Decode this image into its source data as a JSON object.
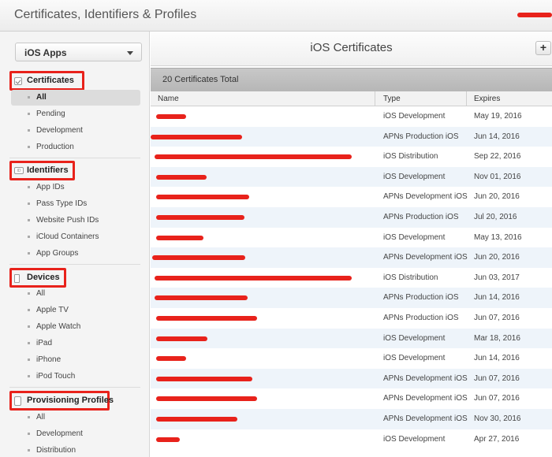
{
  "header": {
    "title": "Certificates, Identifiers & Profiles"
  },
  "sidebar": {
    "select_value": "iOS Apps",
    "sections": [
      {
        "label": "Certificates",
        "icon": "certificate-icon",
        "items": [
          "All",
          "Pending",
          "Development",
          "Production"
        ]
      },
      {
        "label": "Identifiers",
        "icon": "id-icon",
        "items": [
          "App IDs",
          "Pass Type IDs",
          "Website Push IDs",
          "iCloud Containers",
          "App Groups"
        ]
      },
      {
        "label": "Devices",
        "icon": "device-icon",
        "items": [
          "All",
          "Apple TV",
          "Apple Watch",
          "iPad",
          "iPhone",
          "iPod Touch"
        ]
      },
      {
        "label": "Provisioning Profiles",
        "icon": "profile-icon",
        "items": [
          "All",
          "Development",
          "Distribution"
        ]
      }
    ]
  },
  "main": {
    "title": "iOS Certificates",
    "add_label": "+",
    "total": "20 Certificates Total",
    "columns": [
      "Name",
      "Type",
      "Expires"
    ],
    "rows": [
      {
        "type": "iOS Development",
        "expires": "May 19, 2016"
      },
      {
        "type": "APNs Production iOS",
        "expires": "Jun 14, 2016"
      },
      {
        "type": "iOS Distribution",
        "expires": "Sep 22, 2016"
      },
      {
        "type": "iOS Development",
        "expires": "Nov 01, 2016"
      },
      {
        "type": "APNs Development iOS",
        "expires": "Jun 20, 2016"
      },
      {
        "type": "APNs Production iOS",
        "expires": "Jul 20, 2016"
      },
      {
        "type": "iOS Development",
        "expires": "May 13, 2016"
      },
      {
        "type": "APNs Development iOS",
        "expires": "Jun 20, 2016"
      },
      {
        "type": "iOS Distribution",
        "expires": "Jun 03, 2017"
      },
      {
        "type": "APNs Production iOS",
        "expires": "Jun 14, 2016"
      },
      {
        "type": "APNs Production iOS",
        "expires": "Jun 07, 2016"
      },
      {
        "type": "iOS Development",
        "expires": "Mar 18, 2016"
      },
      {
        "type": "iOS Development",
        "expires": "Jun 14, 2016"
      },
      {
        "type": "APNs Development iOS",
        "expires": "Jun 07, 2016"
      },
      {
        "type": "APNs Development iOS",
        "expires": "Jun 07, 2016"
      },
      {
        "type": "APNs Development iOS",
        "expires": "Nov 30, 2016"
      },
      {
        "type": "iOS Development",
        "expires": "Apr 27, 2016"
      }
    ]
  },
  "colors": {
    "redaction": "#e8221b",
    "row_alt": "#eef4fa"
  }
}
